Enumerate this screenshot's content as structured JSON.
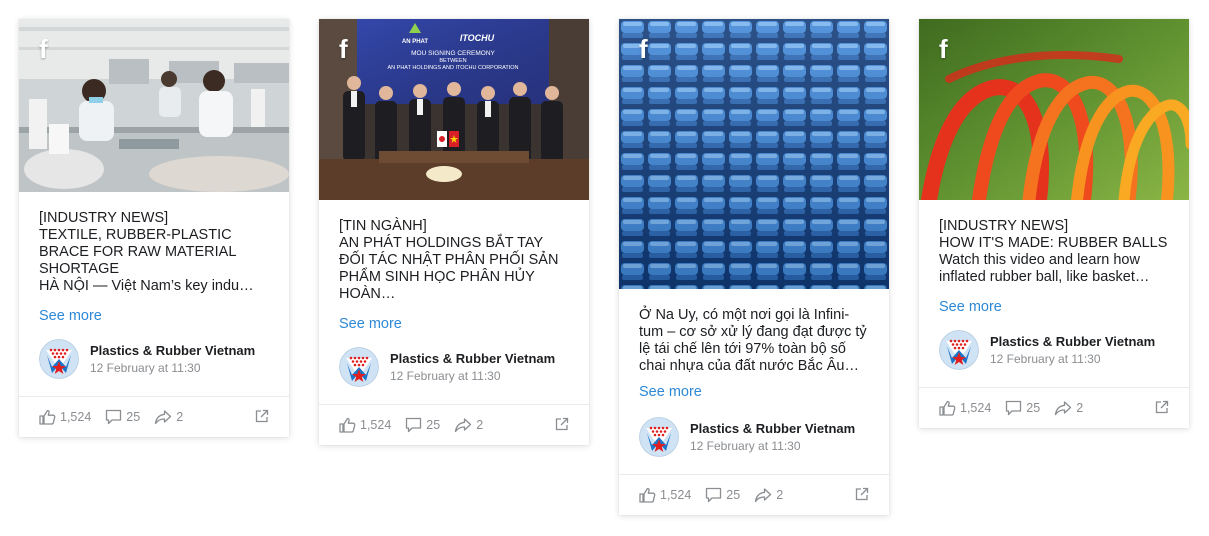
{
  "posts": [
    {
      "text": "[INDUSTRY NEWS]\nTEXTILE, RUBBER-PLASTIC BRACE FOR RAW MATERIAL SHORTAGE\nHÀ NỘI — Việt Nam’s key indu…",
      "see_more": "See more",
      "page_name": "Plastics & Rubber Vietnam",
      "time": "12 February at 11:30",
      "likes": "1,524",
      "comments": "25",
      "shares": "2"
    },
    {
      "text": "[TIN NGÀNH]\nAN PHÁT HOLDINGS BẮT TAY ĐỐI TÁC NHẬT PHÂN PHỐI SẢN PHẨM SINH HỌC PHÂN HỦY HOÀN…",
      "see_more": "See more",
      "page_name": "Plastics & Rubber Vietnam",
      "time": "12 February at 11:30",
      "likes": "1,524",
      "comments": "25",
      "shares": "2",
      "banner": {
        "logo_left": "AN PHAT",
        "logo_right": "ITOCHU",
        "line1": "MOU SIGNING CEREMONY",
        "line2": "BETWEEN",
        "line3": "AN PHAT HOLDINGS AND ITOCHU CORPORATION"
      }
    },
    {
      "text": "Ở Na Uy, có một nơi gọi là Infini-\ntum – cơ sở xử lý đang đạt được tỷ lệ tái chế lên tới 97% toàn bộ số chai nhựa của đất nước Bắc Âu…",
      "see_more": "See more",
      "page_name": "Plastics & Rubber Vietnam",
      "time": "12 February at 11:30",
      "likes": "1,524",
      "comments": "25",
      "shares": "2"
    },
    {
      "text": "[INDUSTRY NEWS]\nHOW IT'S MADE: RUBBER BALLS\nWatch this video and learn how inflated rubber ball, like basket…",
      "see_more": "See more",
      "page_name": "Plastics & Rubber Vietnam",
      "time": "12 February at 11:30",
      "likes": "1,524",
      "comments": "25",
      "shares": "2"
    }
  ],
  "icons": {
    "brand": "facebook-icon",
    "like": "thumbs-up-icon",
    "comment": "comment-icon",
    "share": "share-icon",
    "external": "external-link-icon"
  },
  "colors": {
    "link": "#2d88d6",
    "muted": "#8a8d91",
    "avatar_blue": "#1d74c8",
    "avatar_red": "#e02020"
  }
}
